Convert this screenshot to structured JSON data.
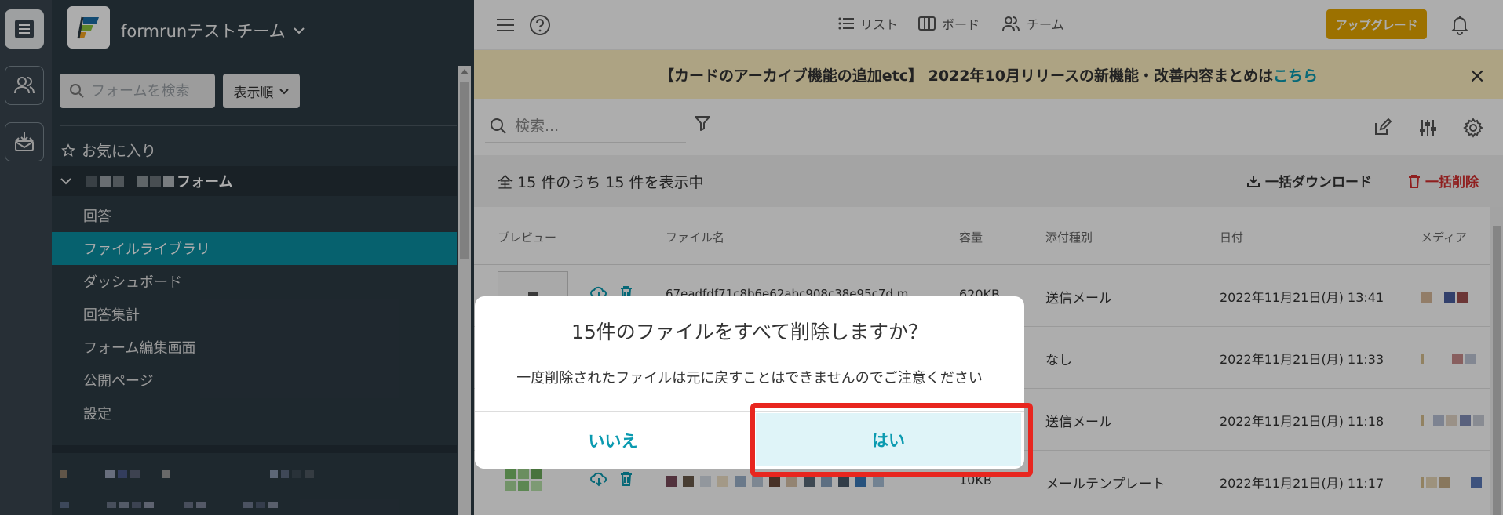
{
  "rail": {
    "items": [
      "app-menu-icon",
      "team-members-icon",
      "inbox-download-icon"
    ]
  },
  "sidebar": {
    "team_name": "formrunテストチーム",
    "search_placeholder": "フォームを検索",
    "sort_label": "表示順",
    "favorites_label": "お気に入り",
    "form_name": "フォーム",
    "nav": [
      {
        "label": "回答",
        "active": false
      },
      {
        "label": "ファイルライブラリ",
        "active": true
      },
      {
        "label": "ダッシュボード",
        "active": false
      },
      {
        "label": "回答集計",
        "active": false
      },
      {
        "label": "フォーム編集画面",
        "active": false
      },
      {
        "label": "公開ページ",
        "active": false
      },
      {
        "label": "設定",
        "active": false
      }
    ]
  },
  "topbar": {
    "tabs": [
      {
        "label": "リスト",
        "icon": "list-icon"
      },
      {
        "label": "ボード",
        "icon": "board-icon"
      },
      {
        "label": "チーム",
        "icon": "team-icon"
      }
    ],
    "upgrade_label": "アップグレード"
  },
  "banner": {
    "text": "【カードのアーカイブ機能の追加etc】 2022年10月リリースの新機能・改善内容まとめは",
    "link": "こちら",
    "close": "×"
  },
  "toolbar": {
    "search_placeholder": "検索..."
  },
  "summary": {
    "count_text": "全 15 件のうち 15 件を表示中",
    "bulk_download": "一括ダウンロード",
    "bulk_delete": "一括削除"
  },
  "table": {
    "headers": {
      "preview": "プレビュー",
      "filename": "ファイル名",
      "size": "容量",
      "type": "添付種別",
      "date": "日付",
      "media": "メディア"
    },
    "rows": [
      {
        "filename": "67eadfdf71c8b6e62abc908c38e95c7d.m",
        "size": "620KB",
        "type": "送信メール",
        "date": "2022年11月21日(月) 13:41"
      },
      {
        "filename": "",
        "size": "",
        "type": "なし",
        "date": "2022年11月21日(月) 11:33"
      },
      {
        "filename": "",
        "size": "",
        "type": "送信メール",
        "date": "2022年11月21日(月) 11:18"
      },
      {
        "filename": "",
        "size": "10KB",
        "type": "メールテンプレート",
        "date": "2022年11月21日(月) 11:17"
      }
    ]
  },
  "dialog": {
    "title": "15件のファイルをすべて削除しますか？",
    "message": "一度削除されたファイルは元に戻すことはできませんのでご注意ください",
    "no_label": "いいえ",
    "yes_label": "はい"
  },
  "colors": {
    "accent": "#0a9ab0",
    "sidebar_bg": "#2d3b45",
    "active_nav": "#0a8fa3",
    "upgrade": "#e6a700",
    "banner_bg": "#fff1c2",
    "danger": "#d32f2f",
    "highlight": "#e8261f"
  }
}
